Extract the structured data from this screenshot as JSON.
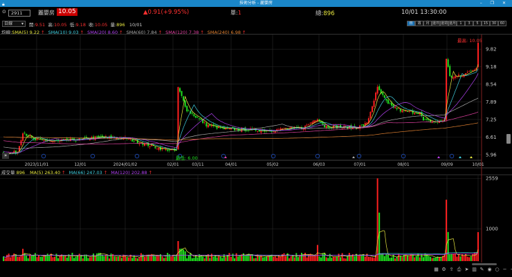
{
  "window": {
    "title": "技術分析 - 麗嬰房",
    "controls": "– ❐ ✕"
  },
  "header": {
    "code": "2911",
    "name": "麗嬰房",
    "price": "10.05",
    "change": "▲0.91(+9.95%)",
    "single_label": "單:",
    "single_value": "1",
    "total_label": "總:",
    "total_value": "896",
    "datetime": "10/01 13:30:00"
  },
  "ohlc": {
    "period": "日線",
    "open_label": "開:",
    "open": "9.51",
    "high_label": "高:",
    "high": "10.05",
    "low_label": "低:",
    "low": "9.18",
    "close_label": "收:",
    "close": "10.05",
    "vol_label": "量:",
    "vol": "896",
    "date": "10/01"
  },
  "period_buttons": [
    "日",
    "週",
    "月",
    "還日",
    "還週",
    "還月",
    "1",
    "3",
    "5",
    "15",
    "30",
    "60"
  ],
  "sma": {
    "label": "均線:",
    "items": [
      {
        "text": "SMA(5) 9.22",
        "color": "#e8e840"
      },
      {
        "text": "SMA(10) 9.03",
        "color": "#40d0e0"
      },
      {
        "text": "SMA(20) 8.60",
        "color": "#b040f0"
      },
      {
        "text": "SMA(60) 7.84",
        "color": "#a8a8a8"
      },
      {
        "text": "SMA(120) 7.38",
        "color": "#e040a0"
      },
      {
        "text": "SMA(240) 6.98",
        "color": "#e08030"
      }
    ],
    "arrow": "↑"
  },
  "volume": {
    "label": "成交量",
    "value": "896",
    "items": [
      {
        "text": "MA(5) 263.40",
        "color": "#e8e840"
      },
      {
        "text": "MA(66) 247.03",
        "color": "#40d0e0"
      },
      {
        "text": "MA(120) 202.88",
        "color": "#b040f0"
      }
    ],
    "arrow": "↑"
  },
  "price_axis": [
    "9.82",
    "9.18",
    "8.54",
    "7.89",
    "7.25",
    "6.61",
    "5.96"
  ],
  "volume_axis": [
    "2559",
    "1000"
  ],
  "date_axis": [
    "2023/11/01",
    "12/01",
    "2024/01/02",
    "02/01",
    "03/11",
    "04/01",
    "05/02",
    "06/03",
    "07/01",
    "08/01",
    "09/09",
    "10/01"
  ],
  "annotations": {
    "high": "最高: 10.05",
    "low": "最低: 6.00"
  },
  "colors": {
    "up": "#ff2020",
    "down": "#20e020",
    "title_bar": "#1a86c8"
  },
  "toolbar_icons": [
    "grid-icon",
    "chart-settings-icon",
    "export-icon",
    "print-icon",
    "cursor-icon",
    "layout-icon",
    "drawing-icon",
    "eye-icon",
    "circle-icon",
    "zoom-out-icon",
    "zoom-in-icon"
  ]
}
